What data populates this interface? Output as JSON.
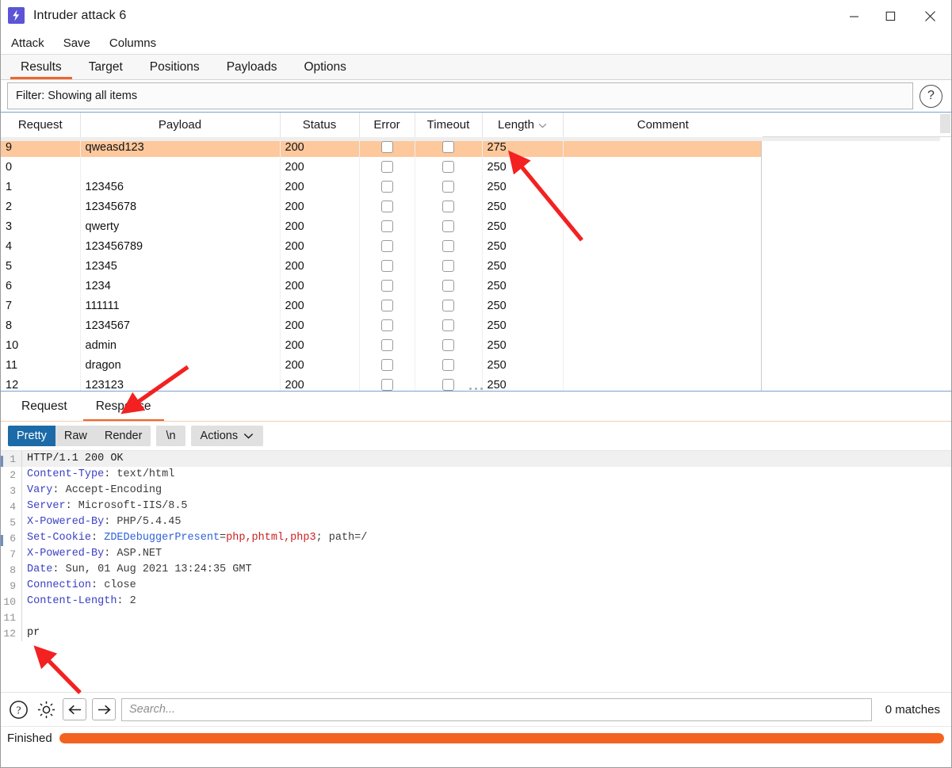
{
  "window": {
    "title": "Intruder attack 6",
    "icon": "lightning-bolt-icon",
    "minimize_label": "–",
    "maximize_label": "□",
    "close_label": "✕"
  },
  "menubar": {
    "items": [
      {
        "label": "Attack"
      },
      {
        "label": "Save"
      },
      {
        "label": "Columns"
      }
    ]
  },
  "tabs": {
    "items": [
      {
        "label": "Results",
        "active": true
      },
      {
        "label": "Target",
        "active": false
      },
      {
        "label": "Positions",
        "active": false
      },
      {
        "label": "Payloads",
        "active": false
      },
      {
        "label": "Options",
        "active": false
      }
    ]
  },
  "filter": {
    "text": "Filter: Showing all items",
    "help_label": "?"
  },
  "results_table": {
    "columns": [
      {
        "label": "Request"
      },
      {
        "label": "Payload"
      },
      {
        "label": "Status"
      },
      {
        "label": "Error"
      },
      {
        "label": "Timeout"
      },
      {
        "label": "Length",
        "sorted": true,
        "sort_icon": "chevron-down-icon"
      },
      {
        "label": "Comment"
      }
    ],
    "rows": [
      {
        "request": "9",
        "payload": "qweasd123",
        "status": "200",
        "error": false,
        "timeout": false,
        "length": "275",
        "comment": "",
        "selected": true
      },
      {
        "request": "0",
        "payload": "",
        "status": "200",
        "error": false,
        "timeout": false,
        "length": "250",
        "comment": "",
        "selected": false
      },
      {
        "request": "1",
        "payload": "123456",
        "status": "200",
        "error": false,
        "timeout": false,
        "length": "250",
        "comment": "",
        "selected": false
      },
      {
        "request": "2",
        "payload": "12345678",
        "status": "200",
        "error": false,
        "timeout": false,
        "length": "250",
        "comment": "",
        "selected": false
      },
      {
        "request": "3",
        "payload": "qwerty",
        "status": "200",
        "error": false,
        "timeout": false,
        "length": "250",
        "comment": "",
        "selected": false
      },
      {
        "request": "4",
        "payload": "123456789",
        "status": "200",
        "error": false,
        "timeout": false,
        "length": "250",
        "comment": "",
        "selected": false
      },
      {
        "request": "5",
        "payload": "12345",
        "status": "200",
        "error": false,
        "timeout": false,
        "length": "250",
        "comment": "",
        "selected": false
      },
      {
        "request": "6",
        "payload": "1234",
        "status": "200",
        "error": false,
        "timeout": false,
        "length": "250",
        "comment": "",
        "selected": false
      },
      {
        "request": "7",
        "payload": "111111",
        "status": "200",
        "error": false,
        "timeout": false,
        "length": "250",
        "comment": "",
        "selected": false
      },
      {
        "request": "8",
        "payload": "1234567",
        "status": "200",
        "error": false,
        "timeout": false,
        "length": "250",
        "comment": "",
        "selected": false
      },
      {
        "request": "10",
        "payload": "admin",
        "status": "200",
        "error": false,
        "timeout": false,
        "length": "250",
        "comment": "",
        "selected": false
      },
      {
        "request": "11",
        "payload": "dragon",
        "status": "200",
        "error": false,
        "timeout": false,
        "length": "250",
        "comment": "",
        "selected": false
      },
      {
        "request": "12",
        "payload": "123123",
        "status": "200",
        "error": false,
        "timeout": false,
        "length": "250",
        "comment": "",
        "selected": false
      }
    ]
  },
  "message_tabs": {
    "items": [
      {
        "label": "Request",
        "active": false
      },
      {
        "label": "Response",
        "active": true
      }
    ]
  },
  "view_toolbar": {
    "segments": [
      {
        "label": "Pretty",
        "active": true
      },
      {
        "label": "Raw",
        "active": false
      },
      {
        "label": "Render",
        "active": false
      }
    ],
    "newline_label": "\\n",
    "actions_label": "Actions",
    "actions_icon": "chevron-down-icon"
  },
  "response": {
    "lines": [
      {
        "n": "1",
        "parts": [
          {
            "t": "HTTP/1.1 200 OK",
            "c": "plain"
          }
        ]
      },
      {
        "n": "2",
        "parts": [
          {
            "t": "Content-Type",
            "c": "k"
          },
          {
            "t": ": text/html",
            "c": "v"
          }
        ]
      },
      {
        "n": "3",
        "parts": [
          {
            "t": "Vary",
            "c": "k"
          },
          {
            "t": ": Accept-Encoding",
            "c": "v"
          }
        ]
      },
      {
        "n": "4",
        "parts": [
          {
            "t": "Server",
            "c": "k"
          },
          {
            "t": ": Microsoft-IIS/8.5",
            "c": "v"
          }
        ]
      },
      {
        "n": "5",
        "parts": [
          {
            "t": "X-Powered-By",
            "c": "k"
          },
          {
            "t": ": PHP/5.4.45",
            "c": "v"
          }
        ]
      },
      {
        "n": "6",
        "parts": [
          {
            "t": "Set-Cookie",
            "c": "k"
          },
          {
            "t": ": ",
            "c": "v"
          },
          {
            "t": "ZDEDebuggerPresent",
            "c": "ck"
          },
          {
            "t": "=",
            "c": "v"
          },
          {
            "t": "php,phtml,php3",
            "c": "cv"
          },
          {
            "t": "; path=/",
            "c": "v"
          }
        ]
      },
      {
        "n": "7",
        "parts": [
          {
            "t": "X-Powered-By",
            "c": "k"
          },
          {
            "t": ": ASP.NET",
            "c": "v"
          }
        ]
      },
      {
        "n": "8",
        "parts": [
          {
            "t": "Date",
            "c": "k"
          },
          {
            "t": ": Sun, 01 Aug 2021 13:24:35 GMT",
            "c": "v"
          }
        ]
      },
      {
        "n": "9",
        "parts": [
          {
            "t": "Connection",
            "c": "k"
          },
          {
            "t": ": close",
            "c": "v"
          }
        ]
      },
      {
        "n": "10",
        "parts": [
          {
            "t": "Content-Length",
            "c": "k"
          },
          {
            "t": ": 2",
            "c": "v"
          }
        ]
      },
      {
        "n": "11",
        "parts": [
          {
            "t": "",
            "c": "plain"
          }
        ]
      },
      {
        "n": "12",
        "parts": [
          {
            "t": "pr",
            "c": "plain"
          }
        ]
      }
    ]
  },
  "search": {
    "placeholder": "Search...",
    "value": "",
    "matches_label": "0 matches",
    "help_icon": "help-circle-icon",
    "settings_icon": "gear-icon",
    "prev_icon": "arrow-left-icon",
    "next_icon": "arrow-right-icon"
  },
  "status": {
    "text": "Finished",
    "progress_percent": 100,
    "progress_color": "#f4621f"
  },
  "colors": {
    "accent": "#f0662b",
    "selection": "#fdc89b",
    "segment_active": "#1c6ba8",
    "app_icon": "#5b55d6",
    "annotation_arrow": "#f32121"
  }
}
